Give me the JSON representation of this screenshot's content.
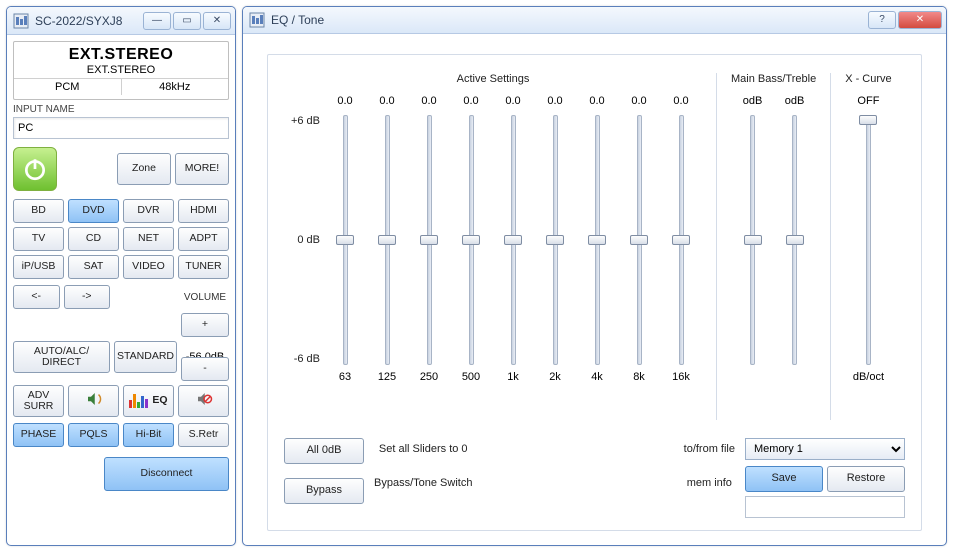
{
  "left_window": {
    "title": "SC-2022/SYXJ8",
    "banner": {
      "big": "EXT.STEREO",
      "sub": "EXT.STEREO",
      "codec": "PCM",
      "rate": "48kHz"
    },
    "input_name_label": "INPUT NAME",
    "input_name_value": "PC",
    "zone_btn": "Zone",
    "more_btn": "MORE!",
    "sources": [
      "BD",
      "DVD",
      "DVR",
      "HDMI",
      "TV",
      "CD",
      "NET",
      "ADPT",
      "iP/USB",
      "SAT",
      "VIDEO",
      "TUNER"
    ],
    "active_source_index": 1,
    "arrows": {
      "left": "<-",
      "right": "->"
    },
    "volume_label": "VOLUME",
    "vol_plus": "+",
    "vol_minus": "-",
    "vol_readout": "-56.0dB",
    "mode_auto": "AUTO/ALC/\nDIRECT",
    "mode_std": "STANDARD",
    "adv_surr": "ADV\nSURR",
    "eq_btn": "EQ",
    "bottom_row": [
      "PHASE",
      "PQLS",
      "Hi-Bit",
      "S.Retr"
    ],
    "bottom_blue": [
      0,
      1,
      2
    ],
    "disconnect": "Disconnect"
  },
  "eq_window": {
    "title": "EQ / Tone",
    "active_heading": "Active Settings",
    "bass_treble_heading": "Main Bass/Treble",
    "xcurve_heading": "X - Curve",
    "scale_top": "+6 dB",
    "scale_mid": "0 dB",
    "scale_bot": "-6 dB",
    "bands": [
      {
        "freq": "63",
        "val": "0.0",
        "pos": 50
      },
      {
        "freq": "125",
        "val": "0.0",
        "pos": 50
      },
      {
        "freq": "250",
        "val": "0.0",
        "pos": 50
      },
      {
        "freq": "500",
        "val": "0.0",
        "pos": 50
      },
      {
        "freq": "1k",
        "val": "0.0",
        "pos": 50
      },
      {
        "freq": "2k",
        "val": "0.0",
        "pos": 50
      },
      {
        "freq": "4k",
        "val": "0.0",
        "pos": 50
      },
      {
        "freq": "8k",
        "val": "0.0",
        "pos": 50
      },
      {
        "freq": "16k",
        "val": "0.0",
        "pos": 50
      }
    ],
    "bass_treble": [
      {
        "label": "",
        "val": "odB",
        "pos": 50
      },
      {
        "label": "",
        "val": "odB",
        "pos": 50
      }
    ],
    "xcurve": {
      "val": "OFF",
      "pos": 2,
      "unit": "dB/oct"
    },
    "all0_btn": "All 0dB",
    "all0_desc": "Set all Sliders to 0",
    "tofrom": "to/from file",
    "bypass_btn": "Bypass",
    "bypass_desc": "Bypass/Tone Switch",
    "meminfo_label": "mem info",
    "memory_options": [
      "Memory 1"
    ],
    "memory_selected": "Memory 1",
    "save_btn": "Save",
    "restore_btn": "Restore"
  }
}
